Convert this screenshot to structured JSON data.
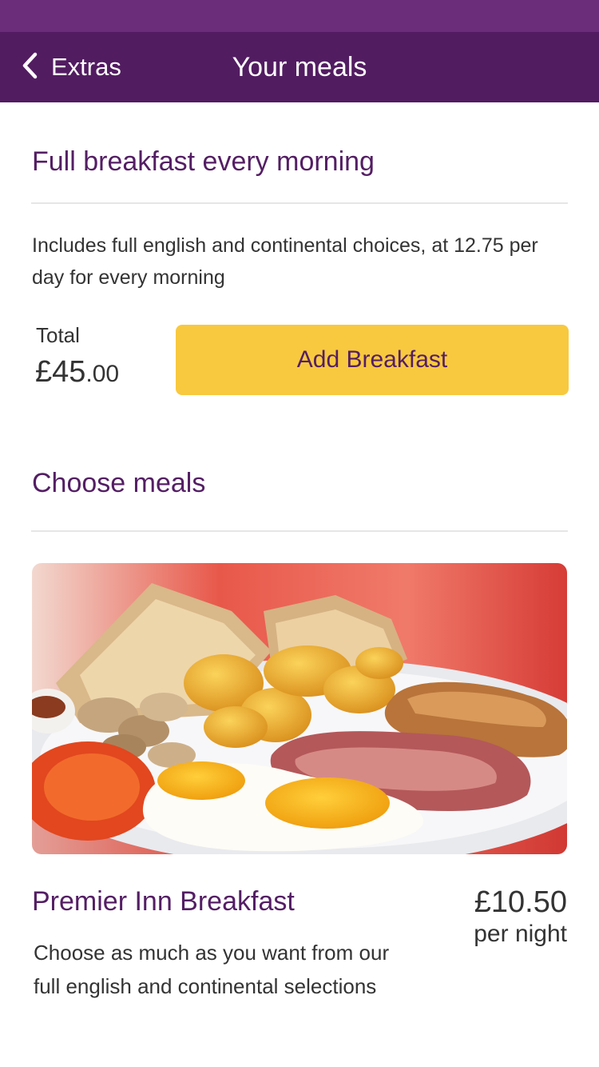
{
  "header": {
    "back_label": "Extras",
    "title": "Your meals"
  },
  "breakfast_section": {
    "heading": "Full breakfast every morning",
    "description": "Includes full english and continental choices, at 12.75 per day for every morning",
    "total_label": "Total",
    "total_major": "£45",
    "total_minor": ".00",
    "add_button_label": "Add Breakfast"
  },
  "meals_section": {
    "heading": "Choose meals",
    "items": [
      {
        "name": "Premier Inn Breakfast",
        "description": "Choose as much as you want from our full english and continental selections",
        "price": "£10.50",
        "price_unit": "per night"
      }
    ]
  },
  "colors": {
    "brand_purple": "#541e64",
    "status_bar": "#6b2d7a",
    "accent_yellow": "#f8c93f"
  },
  "icons": [
    "chevron-left-icon"
  ]
}
